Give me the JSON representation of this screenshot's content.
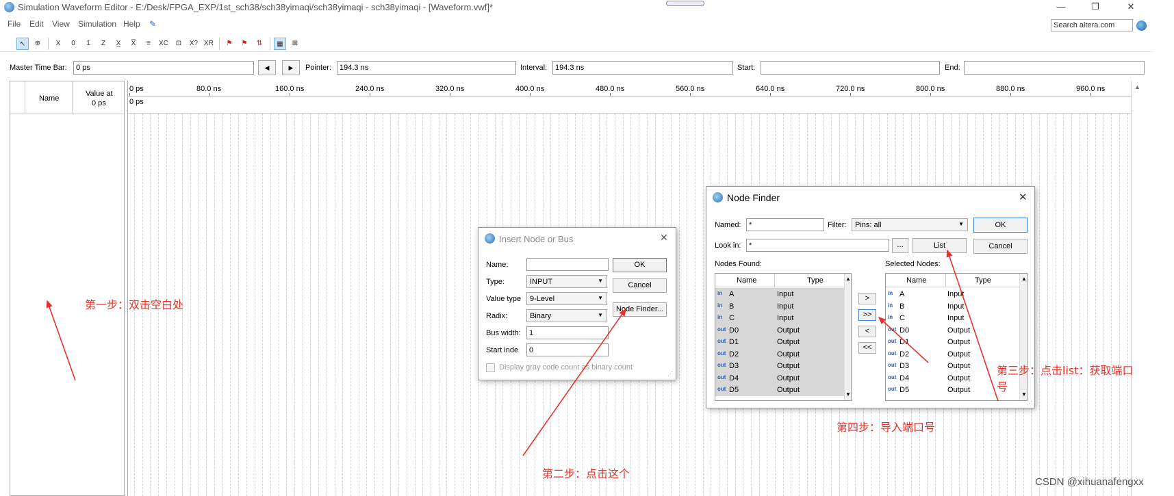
{
  "window": {
    "title": "Simulation Waveform Editor - E:/Desk/FPGA_EXP/1st_sch38/sch38yimaqi/sch38yimaqi - sch38yimaqi - [Waveform.vwf]*",
    "minimize": "—",
    "restore": "❐",
    "close": "✕"
  },
  "menu": {
    "items": [
      "File",
      "Edit",
      "View",
      "Simulation",
      "Help"
    ],
    "search_placeholder": "Search altera.com"
  },
  "toolbar": {
    "icons": [
      "pointer-tool-icon",
      "zoom-tool-icon",
      "forcing-unknown-icon",
      "forcing-low-icon",
      "forcing-high-icon",
      "high-impedance-icon",
      "weak-unknown-icon",
      "weak-low-icon",
      "invert-icon",
      "count-value-icon",
      "clock-icon",
      "random-value-icon",
      "arbitrary-value-icon",
      "snap-grid-icon",
      "group-icon",
      "ungroup-icon",
      "sort-icon",
      "grid-icon",
      "overwrite-clock-icon"
    ]
  },
  "timebar": {
    "master_label": "Master Time Bar:",
    "master_value": "0 ps",
    "prev": "◀",
    "next": "▶",
    "pointer_label": "Pointer:",
    "pointer_value": "194.3 ns",
    "interval_label": "Interval:",
    "interval_value": "194.3 ns",
    "start_label": "Start:",
    "start_value": "",
    "end_label": "End:",
    "end_value": ""
  },
  "wave": {
    "name_header": "Name",
    "value_header_1": "Value at",
    "value_header_2": "0 ps",
    "ruler": [
      "0 ps",
      "80.0 ns",
      "160.0 ns",
      "240.0 ns",
      "320.0 ns",
      "400.0 ns",
      "480.0 ns",
      "560.0 ns",
      "640.0 ns",
      "720.0 ns",
      "800.0 ns",
      "880.0 ns",
      "960.0 ns"
    ],
    "cursor_label": "0 ps"
  },
  "insert_dialog": {
    "title": "Insert Node or Bus",
    "name_label": "Name:",
    "name_value": "",
    "type_label": "Type:",
    "type_value": "INPUT",
    "value_type_label": "Value type",
    "value_type_value": "9-Level",
    "radix_label": "Radix:",
    "radix_value": "Binary",
    "bus_width_label": "Bus width:",
    "bus_width_value": "1",
    "start_index_label": "Start inde",
    "start_index_value": "0",
    "gray_label": "Display gray code count as binary count",
    "ok": "OK",
    "cancel": "Cancel",
    "node_finder": "Node Finder..."
  },
  "node_finder": {
    "title": "Node Finder",
    "named_label": "Named:",
    "named_value": "*",
    "filter_label": "Filter:",
    "filter_value": "Pins: all",
    "look_in_label": "Look in:",
    "look_in_value": "*",
    "browse": "...",
    "list": "List",
    "ok": "OK",
    "cancel": "Cancel",
    "found_label": "Nodes Found:",
    "selected_label": "Selected Nodes:",
    "col_name": "Name",
    "col_type": "Type",
    "move_one": ">",
    "move_all": ">>",
    "remove_one": "<",
    "remove_all": "<<",
    "found_rows": [
      {
        "pin": "in",
        "name": "A",
        "type": "Input"
      },
      {
        "pin": "in",
        "name": "B",
        "type": "Input"
      },
      {
        "pin": "in",
        "name": "C",
        "type": "Input"
      },
      {
        "pin": "out",
        "name": "D0",
        "type": "Output"
      },
      {
        "pin": "out",
        "name": "D1",
        "type": "Output"
      },
      {
        "pin": "out",
        "name": "D2",
        "type": "Output"
      },
      {
        "pin": "out",
        "name": "D3",
        "type": "Output"
      },
      {
        "pin": "out",
        "name": "D4",
        "type": "Output"
      },
      {
        "pin": "out",
        "name": "D5",
        "type": "Output"
      }
    ],
    "selected_rows": [
      {
        "pin": "in",
        "name": "A",
        "type": "Input"
      },
      {
        "pin": "in",
        "name": "B",
        "type": "Input"
      },
      {
        "pin": "in",
        "name": "C",
        "type": "Input"
      },
      {
        "pin": "out",
        "name": "D0",
        "type": "Output"
      },
      {
        "pin": "out",
        "name": "D1",
        "type": "Output"
      },
      {
        "pin": "out",
        "name": "D2",
        "type": "Output"
      },
      {
        "pin": "out",
        "name": "D3",
        "type": "Output"
      },
      {
        "pin": "out",
        "name": "D4",
        "type": "Output"
      },
      {
        "pin": "out",
        "name": "D5",
        "type": "Output"
      }
    ]
  },
  "annotations": {
    "step1": "第一步：双击空白处",
    "step2": "第二步：点击这个",
    "step3a": "第三步：点击list：获取端口",
    "step3b": "号",
    "step4": "第四步：导入端口号",
    "color": "#e8312a"
  },
  "watermark": "CSDN @xihuanafengxx"
}
